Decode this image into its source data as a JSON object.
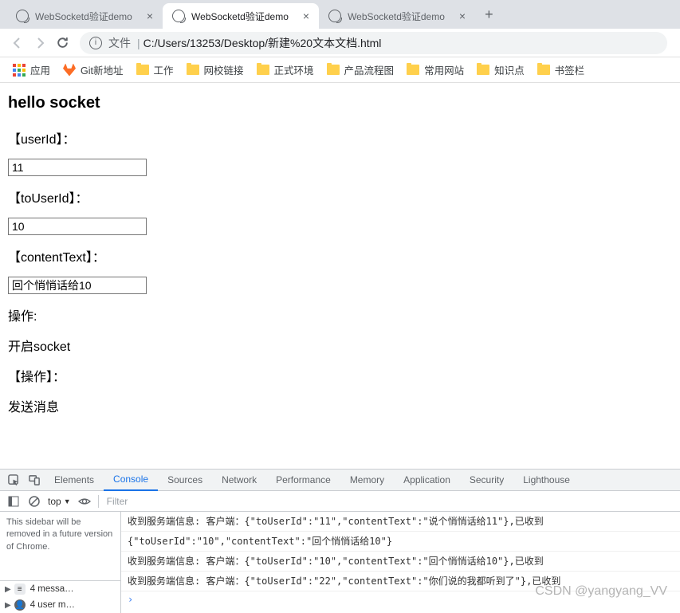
{
  "browser": {
    "tabs": [
      {
        "title": "WebSocketd验证demo"
      },
      {
        "title": "WebSocketd验证demo"
      },
      {
        "title": "WebSocketd验证demo"
      }
    ],
    "url": {
      "file_label": "文件",
      "path": "C:/Users/13253/Desktop/新建%20文本文档.html"
    },
    "bookmarks": {
      "apps": "应用",
      "items": [
        {
          "type": "gitlab",
          "label": "Git新地址"
        },
        {
          "type": "folder",
          "label": "工作"
        },
        {
          "type": "folder",
          "label": "网校链接"
        },
        {
          "type": "folder",
          "label": "正式环境"
        },
        {
          "type": "folder",
          "label": "产品流程图"
        },
        {
          "type": "folder",
          "label": "常用网站"
        },
        {
          "type": "folder",
          "label": "知识点"
        },
        {
          "type": "folder",
          "label": "书签栏"
        }
      ]
    }
  },
  "page": {
    "heading": "hello socket",
    "label_userId": "【userId】：",
    "value_userId": "11",
    "label_toUserId": "【toUserId】：",
    "value_toUserId": "10",
    "label_contentText": "【contentText】：",
    "value_contentText": "回个悄悄话给10",
    "label_op1": "操作:",
    "link_open": "开启socket",
    "label_op2": "【操作】：",
    "link_send": "发送消息"
  },
  "devtools": {
    "tabs": [
      "Elements",
      "Console",
      "Sources",
      "Network",
      "Performance",
      "Memory",
      "Application",
      "Security",
      "Lighthouse"
    ],
    "active_tab": "Console",
    "scope": "top",
    "filter_placeholder": "Filter",
    "sidebar_msg": "This sidebar will be removed in a future version of Chrome.",
    "sidebar_rows": [
      {
        "label": "4 messa…"
      },
      {
        "label": "4 user m…"
      }
    ],
    "console_lines": [
      "收到服务端信息: 客户端：{\"toUserId\":\"11\",\"contentText\":\"说个悄悄话给11\"},已收到",
      "{\"toUserId\":\"10\",\"contentText\":\"回个悄悄话给10\"}",
      "收到服务端信息: 客户端：{\"toUserId\":\"10\",\"contentText\":\"回个悄悄话给10\"},已收到",
      "收到服务端信息: 客户端：{\"toUserId\":\"22\",\"contentText\":\"你们说的我都听到了\"},已收到"
    ]
  },
  "watermark": "CSDN @yangyang_VV"
}
